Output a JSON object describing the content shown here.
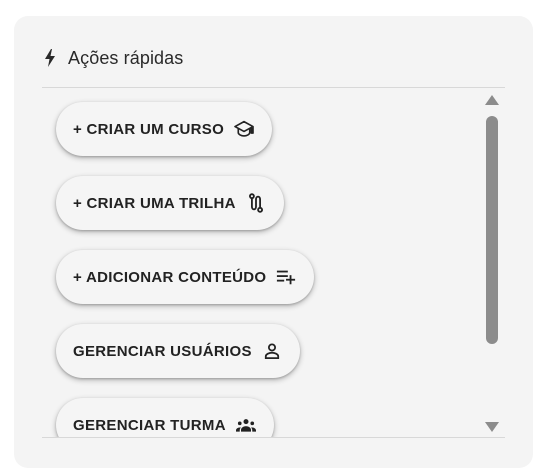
{
  "panel": {
    "title": "Ações rápidas",
    "title_icon": "bolt-icon"
  },
  "actions": [
    {
      "label": "+ CRIAR UM CURSO",
      "icon": "graduation-cap-icon"
    },
    {
      "label": "+ CRIAR UMA TRILHA",
      "icon": "route-icon"
    },
    {
      "label": "+ ADICIONAR CONTEÚDO",
      "icon": "playlist-add-icon"
    },
    {
      "label": "GERENCIAR USUÁRIOS",
      "icon": "person-icon"
    },
    {
      "label": "GERENCIAR TURMA",
      "icon": "group-icon"
    }
  ],
  "colors": {
    "panel_background": "#f4f4f4",
    "button_background": "#f5f5f5",
    "text": "#222222",
    "scrollbar": "#8c8c8c"
  }
}
